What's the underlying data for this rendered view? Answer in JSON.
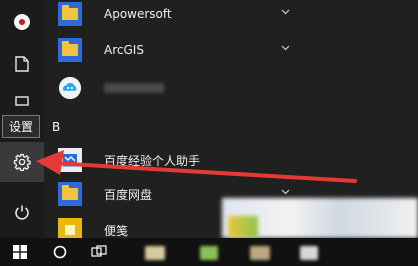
{
  "tooltip": {
    "settings": "设置"
  },
  "sections": {
    "b_header": "B"
  },
  "apps": [
    {
      "name": "Apowersoft",
      "icon": "folder-icon",
      "expandable": true
    },
    {
      "name": "ArcGIS",
      "icon": "folder-icon",
      "expandable": true
    },
    {
      "name": "",
      "icon": "cloud-icon",
      "expandable": false
    },
    {
      "name": "百度经验个人助手",
      "icon": "baidu-jingyan-icon",
      "expandable": false
    },
    {
      "name": "百度网盘",
      "icon": "folder-icon",
      "expandable": true
    },
    {
      "name": "便笺",
      "icon": "sticky-notes-icon",
      "expandable": false
    }
  ],
  "colors": {
    "accent": "#2d6bd8",
    "folder": "#f3c33d",
    "arrow": "#e53935",
    "menu_bg": "#202020",
    "taskbar_bg": "#111111"
  }
}
